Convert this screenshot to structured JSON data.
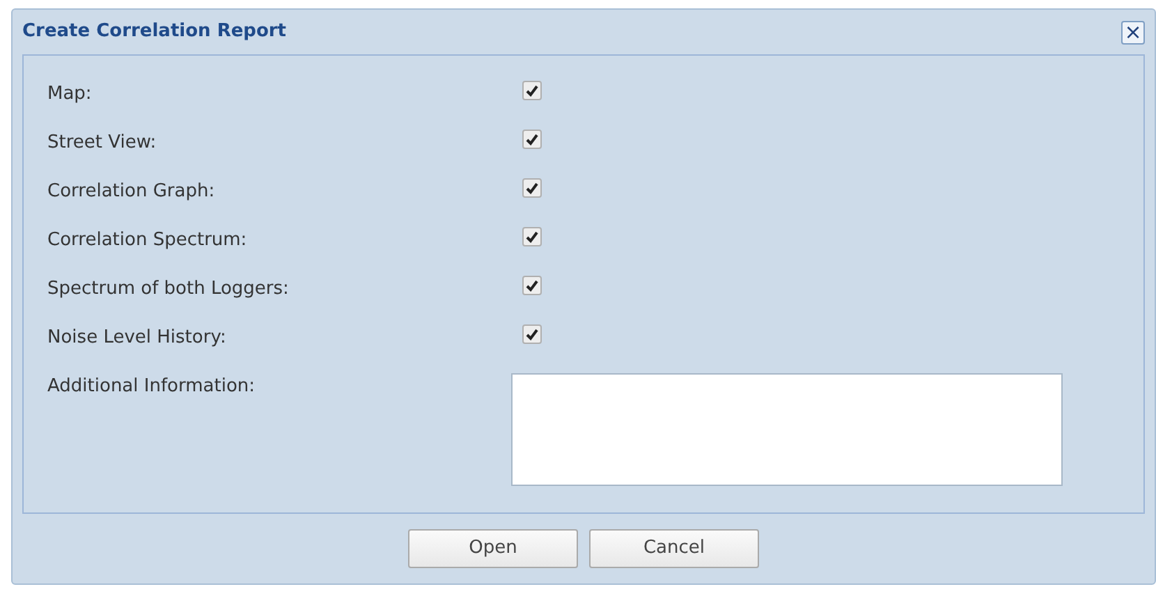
{
  "window": {
    "title": "Create Correlation Report",
    "close": "×"
  },
  "options": [
    {
      "label": "Map:",
      "checked": true
    },
    {
      "label": "Street View:",
      "checked": true
    },
    {
      "label": "Correlation Graph:",
      "checked": true
    },
    {
      "label": "Correlation Spectrum:",
      "checked": true
    },
    {
      "label": "Spectrum of both Loggers:",
      "checked": true
    },
    {
      "label": "Noise Level History:",
      "checked": true
    }
  ],
  "additional": {
    "label": "Additional Information:"
  },
  "buttons": [
    {
      "label": "Open"
    },
    {
      "label": "Cancel"
    }
  ]
}
